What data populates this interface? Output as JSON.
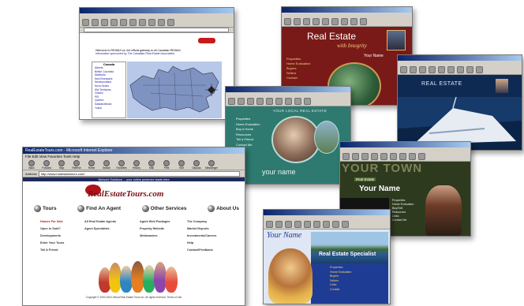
{
  "windows": {
    "canada": {
      "heading_line1": "Welcome to RE/MAX.ca, the official gateway to all Canadian RE/MAX",
      "heading_line2": "Information sponsored by The Canadian Real Estate Association",
      "sidebar_title": "Canada",
      "sidebar_items": [
        "Alberta",
        "British Columbia",
        "Manitoba",
        "New Brunswick",
        "Newfoundland",
        "Nova Scotia",
        "NW Territories",
        "Ontario",
        "PEI",
        "Quebec",
        "Saskatchewan",
        "Yukon"
      ]
    },
    "integrity": {
      "title": "Real Estate",
      "subtitle": "with Integrity",
      "name": "Your Name",
      "nav": [
        "Properties",
        "Home Evaluation",
        "Buyers",
        "Sellers",
        "Contact"
      ]
    },
    "yacht": {
      "title": "REAL ESTATE"
    },
    "local": {
      "header": "YOUR LOCAL REAL ESTATE",
      "nav": [
        "Properties",
        "Home Evaluation",
        "Buy a Home",
        "Resources",
        "Tell a Friend",
        "Contact Me"
      ],
      "name": "your name"
    },
    "yourtown": {
      "big_text": "YOUR TOWN",
      "badge": "Real Estate",
      "name": "Your Name",
      "nav": [
        "Properties",
        "Home Evaluation",
        "Buy/Sell",
        "Resources",
        "Links",
        "Contact Me"
      ]
    },
    "specialist": {
      "name": "Your Name",
      "title": "Real Estate Specialist",
      "nav": [
        "Properties",
        "Home Evaluation",
        "Buyers",
        "Sellers",
        "Links",
        "Contact"
      ]
    },
    "tours": {
      "window_title": "RealEstateTours.com - Microsoft Internet Explorer",
      "menu": "File  Edit  View  Favorites  Tools  Help",
      "toolbar": [
        "Back",
        "Forward",
        "Stop",
        "Refresh",
        "Home",
        "Search",
        "Favorites",
        "History",
        "Mail",
        "Print",
        "Edit",
        "Discuss",
        "Messenger"
      ],
      "address_label": "Address",
      "address_value": "http://www.realestatetours.com/",
      "banner": "Network Solutions ... your online presence starts here",
      "logo": "RealEstateTours.com",
      "nav_headers": [
        "Tours",
        "Find An Agent",
        "Other Services",
        "About Us"
      ],
      "columns": [
        [
          "Homes For Sale",
          "Open In Sold?",
          "Developments",
          "Enter Your Tours",
          "Tell A Friend"
        ],
        [
          "All Real Estate Agents",
          "Agent Specialists"
        ],
        [
          "Agent Web Packages",
          "Property Website",
          "Webmasters"
        ],
        [
          "The Company",
          "Market Reports",
          "Investments/Careers",
          "Help",
          "Contact/Feedback"
        ]
      ],
      "footer": "Copyright © 2000-2004 Virtual Real Estate Tours Inc. All rights reserved. Terms of Use"
    }
  },
  "colors": {
    "ie_title": "#0a246a",
    "integrity_bg": "#7a1a18",
    "local_bg": "#2f7a70",
    "yacht_bg": "#0f2a52",
    "town_bg": "#2e3a1e",
    "specialist_bg": "#1f3c94",
    "tours_red": "#b0141a"
  }
}
